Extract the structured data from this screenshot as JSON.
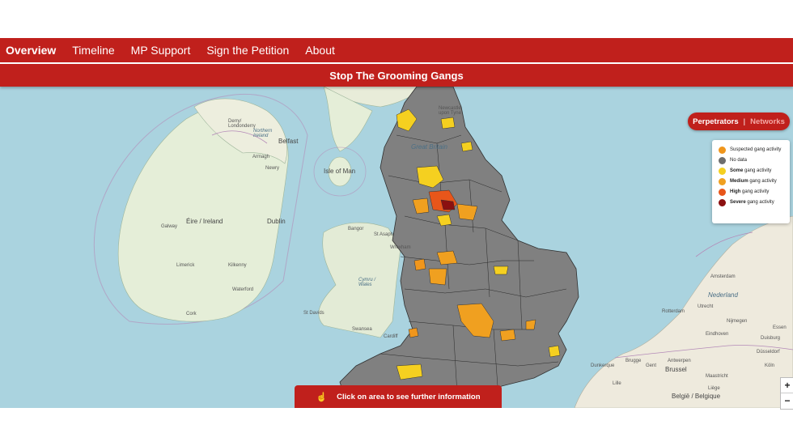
{
  "nav": {
    "items": [
      {
        "label": "Overview",
        "active": true
      },
      {
        "label": "Timeline",
        "active": false
      },
      {
        "label": "MP Support",
        "active": false
      },
      {
        "label": "Sign the Petition",
        "active": false
      },
      {
        "label": "About",
        "active": false
      }
    ],
    "background": "#c0201c"
  },
  "title": "Stop The Grooming Gangs",
  "toggle": {
    "selected": "Perpetrators",
    "separator": "|",
    "unselected": "Networks"
  },
  "legend": [
    {
      "bold": "",
      "text": "Suspected gang activity",
      "color": "#f0961c"
    },
    {
      "bold": "",
      "text": "No data",
      "color": "#6e6e6e"
    },
    {
      "bold": "Some",
      "text": " gang activity",
      "color": "#f5d020"
    },
    {
      "bold": "Medium",
      "text": " gang activity",
      "color": "#f0a020"
    },
    {
      "bold": "High",
      "text": " gang activity",
      "color": "#e8561a"
    },
    {
      "bold": "Severe",
      "text": " gang activity",
      "color": "#8b1010"
    }
  ],
  "cta": {
    "icon": "hand-pointer-icon",
    "label": "Click on area to see further information"
  },
  "zoom": {
    "in": "+",
    "out": "−"
  },
  "places": {
    "derry": "Derry/\nLondonderry",
    "ni": "Northern\nIreland",
    "belfast": "Belfast",
    "armagh": "Armagh",
    "newry": "Newry",
    "eire": "Éire / Ireland",
    "galway": "Galway",
    "dublin": "Dublin",
    "limerick": "Limerick",
    "kilkenny": "Kilkenny",
    "waterford": "Waterford",
    "cork": "Cork",
    "isle_of_man": "Isle of Man",
    "newcastle": "Newcastle\nupon Tyne",
    "great_britain": "Great Britain",
    "bangor": "Bangor",
    "st_asaph": "St Asaph",
    "wrexham": "Wrexham",
    "cymru": "Cymru /\nWales",
    "st_davids": "St Davids",
    "swansea": "Swansea",
    "cardiff": "Cardiff",
    "nederland": "Nederland",
    "amsterdam": "Amsterdam",
    "utrecht": "Utrecht",
    "rotterdam": "Rotterdam",
    "nijmegen": "Nijmegen",
    "eindhoven": "Eindhoven",
    "antwerpen": "Antwerpen",
    "bruxelles": "Brussel",
    "duisburg": "Duisburg",
    "essen": "Essen",
    "dusseldorf": "Düsseldorf",
    "koln": "Köln",
    "maastricht": "Maastricht",
    "liege": "Liège",
    "belgie": "België / Belgique",
    "dunkerque": "Dunkerque",
    "lille": "Lille",
    "brugge": "Brugge",
    "gent": "Gent"
  }
}
